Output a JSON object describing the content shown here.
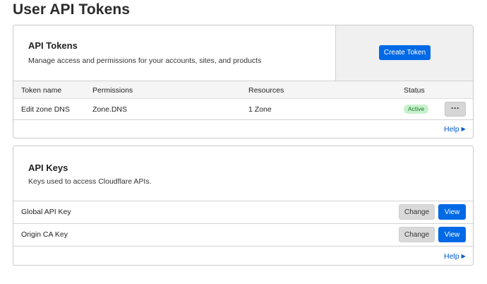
{
  "page": {
    "title": "User API Tokens"
  },
  "tokens_card": {
    "title": "API Tokens",
    "description": "Manage access and permissions for your accounts, sites, and products",
    "create_button": "Create Token",
    "columns": [
      "Token name",
      "Permissions",
      "Resources",
      "Status"
    ],
    "rows": [
      {
        "name": "Edit zone DNS",
        "permissions": "Zone.DNS",
        "resources": "1 Zone",
        "status": "Active",
        "more": "···"
      }
    ],
    "help": "Help"
  },
  "keys_card": {
    "title": "API Keys",
    "description": "Keys used to access Cloudflare APIs.",
    "keys": [
      {
        "label": "Global API Key",
        "change": "Change",
        "view": "View"
      },
      {
        "label": "Origin CA Key",
        "change": "Change",
        "view": "View"
      }
    ],
    "help": "Help"
  },
  "colors": {
    "primary": "#0069e6",
    "active_badge_bg": "#c7f0cc",
    "active_badge_text": "#1a7a2a",
    "link": "#0058c9"
  },
  "icons": {
    "help_chevron": "chevron-right-icon",
    "more": "ellipsis-icon"
  }
}
